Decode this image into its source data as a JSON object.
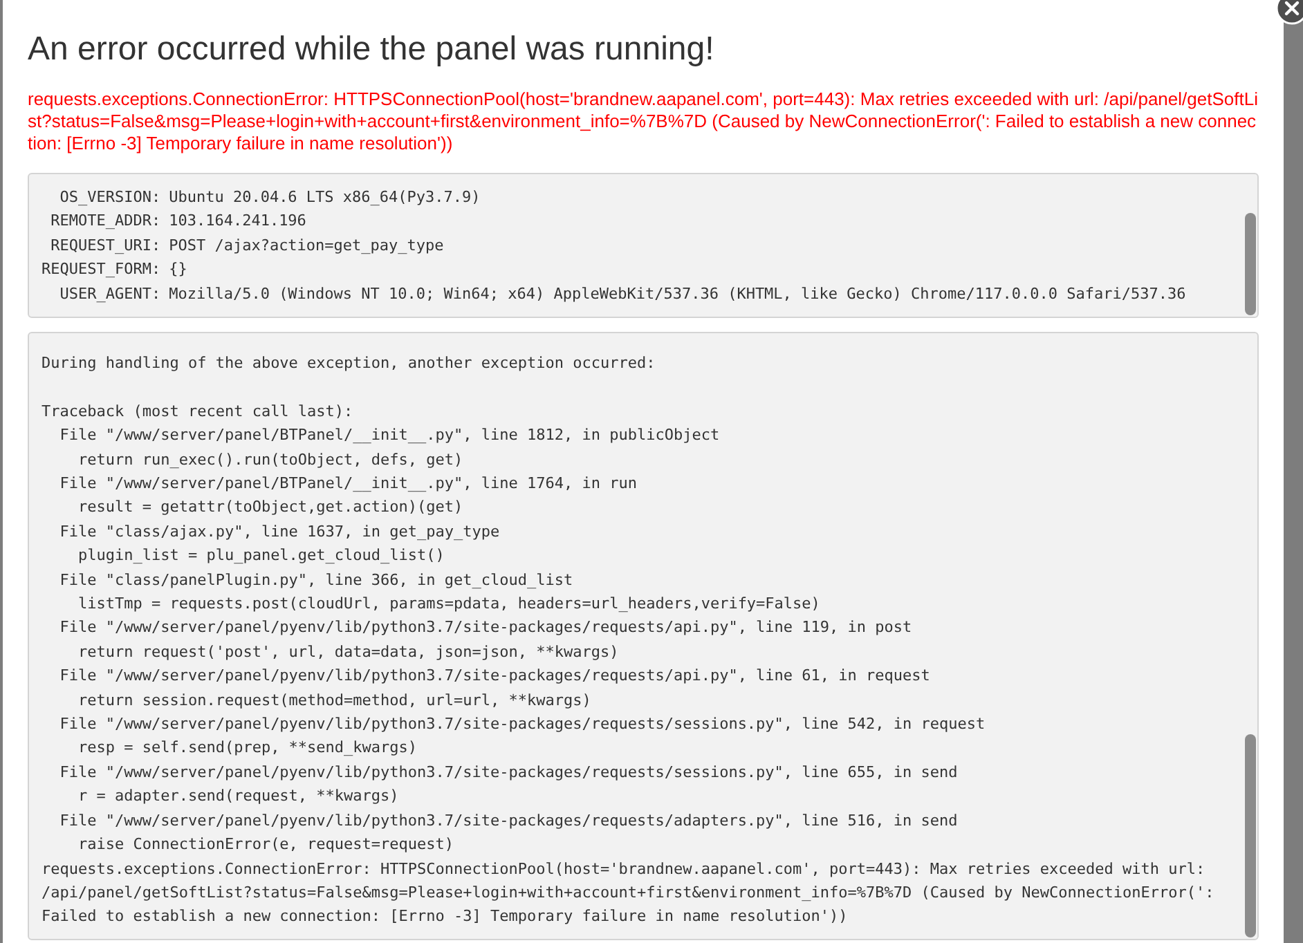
{
  "dialog": {
    "title": "An error occurred while the panel was running!",
    "error_message": "requests.exceptions.ConnectionError: HTTPSConnectionPool(host='brandnew.aapanel.com', port=443): Max retries exceeded with url: /api/panel/getSoftList?status=False&msg=Please+login+with+account+first&environment_info=%7B%7D (Caused by NewConnectionError(': Failed to establish a new connection: [Errno -3] Temporary failure in name resolution'))",
    "request_info": [
      {
        "label": "OS_VERSION:",
        "value": "Ubuntu 20.04.6 LTS x86_64(Py3.7.9)"
      },
      {
        "label": "REMOTE_ADDR:",
        "value": "103.164.241.196"
      },
      {
        "label": "REQUEST_URI:",
        "value": "POST /ajax?action=get_pay_type"
      },
      {
        "label": "REQUEST_FORM:",
        "value": "{}"
      },
      {
        "label": "USER_AGENT:",
        "value": "Mozilla/5.0 (Windows NT 10.0; Win64; x64) AppleWebKit/537.36 (KHTML, like Gecko) Chrome/117.0.0.0 Safari/537.36"
      }
    ],
    "traceback_intro": "During handling of the above exception, another exception occurred:",
    "traceback": [
      "Traceback (most recent call last):",
      "  File \"/www/server/panel/BTPanel/__init__.py\", line 1812, in publicObject",
      "    return run_exec().run(toObject, defs, get)",
      "  File \"/www/server/panel/BTPanel/__init__.py\", line 1764, in run",
      "    result = getattr(toObject,get.action)(get)",
      "  File \"class/ajax.py\", line 1637, in get_pay_type",
      "    plugin_list = plu_panel.get_cloud_list()",
      "  File \"class/panelPlugin.py\", line 366, in get_cloud_list",
      "    listTmp = requests.post(cloudUrl, params=pdata, headers=url_headers,verify=False)",
      "  File \"/www/server/panel/pyenv/lib/python3.7/site-packages/requests/api.py\", line 119, in post",
      "    return request('post', url, data=data, json=json, **kwargs)",
      "  File \"/www/server/panel/pyenv/lib/python3.7/site-packages/requests/api.py\", line 61, in request",
      "    return session.request(method=method, url=url, **kwargs)",
      "  File \"/www/server/panel/pyenv/lib/python3.7/site-packages/requests/sessions.py\", line 542, in request",
      "    resp = self.send(prep, **send_kwargs)",
      "  File \"/www/server/panel/pyenv/lib/python3.7/site-packages/requests/sessions.py\", line 655, in send",
      "    r = adapter.send(request, **kwargs)",
      "  File \"/www/server/panel/pyenv/lib/python3.7/site-packages/requests/adapters.py\", line 516, in send",
      "    raise ConnectionError(e, request=request)",
      "requests.exceptions.ConnectionError: HTTPSConnectionPool(host='brandnew.aapanel.com', port=443): Max retries exceeded with url:",
      "/api/panel/getSoftList?status=False&msg=Please+login+with+account+first&environment_info=%7B%7D (Caused by NewConnectionError(':",
      "Failed to establish a new connection: [Errno -3] Temporary failure in name resolution'))"
    ]
  }
}
